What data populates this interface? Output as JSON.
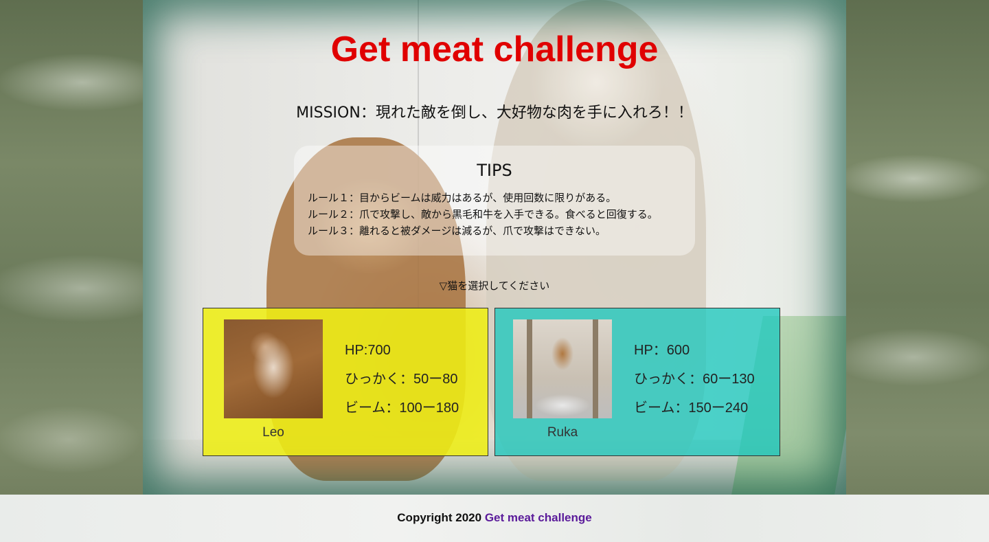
{
  "header": {
    "title": "Get meat challenge",
    "mission": "MISSION：現れた敵を倒し、大好物な肉を手に入れろ！！"
  },
  "tips": {
    "heading": "TIPS",
    "rules": [
      "ルール１：目からビームは威力はあるが、使用回数に限りがある。",
      "ルール２：爪で攻撃し、敵から黒毛和牛を入手できる。食べると回復する。",
      "ルール３：離れると被ダメージは減るが、爪で攻撃はできない。"
    ]
  },
  "select_prompt": "▽猫を選択してください",
  "cats": [
    {
      "name": "Leo",
      "hp": "HP:700",
      "scratch": "ひっかく：50ー80",
      "beam": "ビーム：100ー180",
      "color": "#eeee14"
    },
    {
      "name": "Ruka",
      "hp": "HP：600",
      "scratch": "ひっかく：60ー130",
      "beam": "ビーム：150ー240",
      "color": "#1ec8be"
    }
  ],
  "footer": {
    "prefix": "Copyright 2020",
    "link": "Get meat challenge",
    "link_color": "#5a1a9a"
  },
  "colors": {
    "title": "#e00000"
  }
}
